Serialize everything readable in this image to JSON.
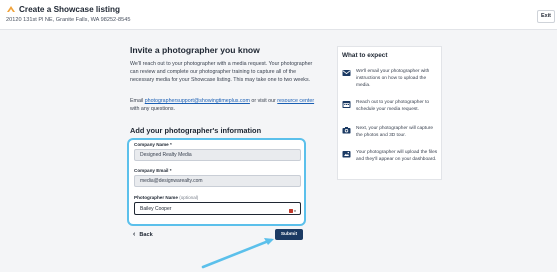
{
  "header": {
    "title": "Create a Showcase listing",
    "address": "20120 131st Pl NE, Granite Falls, WA 98252-8545",
    "exit_label": "Exit"
  },
  "invite": {
    "heading": "Invite a photographer you know",
    "intro": "We'll reach out to your photographer with a media request. Your photographer can review and complete our photographer training to capture all of the necessary media for your Showcase listing. This may take one to two weeks.",
    "contact_prefix": "Email ",
    "contact_email": "photographersupport@showingtimeplus.com",
    "contact_middle": " or visit our ",
    "contact_link": "resource center",
    "contact_suffix": " with any questions."
  },
  "form": {
    "heading": "Add your photographer's information",
    "company_name_label": "Company Name *",
    "company_name_value": "Designed Realty Media",
    "company_email_label": "Company Email *",
    "company_email_value": "media@designwarealty.com",
    "photographer_name_label": "Photographer Name",
    "photographer_name_optional": "(optional)",
    "photographer_name_value": "Bailey Cooper",
    "back_label": "Back",
    "submit_label": "Submit"
  },
  "expect": {
    "heading": "What to expect",
    "steps": [
      {
        "icon": "envelope-icon",
        "text": "We'll email your photographer with instructions on how to upload the media."
      },
      {
        "icon": "calendar-icon",
        "text": "Reach out to your photographer to schedule your media request."
      },
      {
        "icon": "camera-icon",
        "text": "Next, your photographer will capture the photos and 3D tour."
      },
      {
        "icon": "upload-icon",
        "text": "Your photographer will upload the files and they'll appear on your dashboard."
      }
    ]
  },
  "colors": {
    "highlight": "#5bc0eb",
    "primary_button": "#1b3a63",
    "accent_logo": "#f0a23a"
  }
}
